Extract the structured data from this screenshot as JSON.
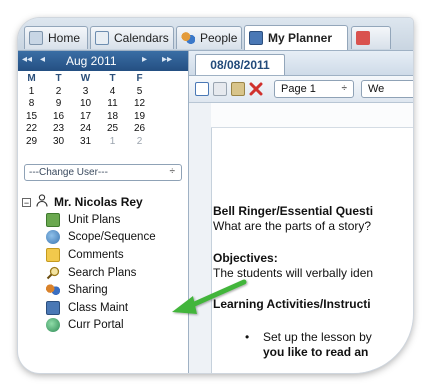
{
  "tabs": [
    {
      "label": "Home",
      "icon": "home-icon"
    },
    {
      "label": "Calendars",
      "icon": "calendar-icon"
    },
    {
      "label": "People",
      "icon": "people-icon"
    },
    {
      "label": "My Planner",
      "icon": "planner-icon",
      "active": true
    }
  ],
  "calendar": {
    "month": "Aug 2011",
    "nav_prev_year": "◂◂",
    "nav_prev": "◂",
    "nav_next": "▸",
    "nav_next_year": "▸▸",
    "day_headers": [
      "M",
      "T",
      "W",
      "T",
      "F"
    ],
    "weeks": [
      [
        "1",
        "2",
        "3",
        "4",
        "5"
      ],
      [
        "8",
        "9",
        "10",
        "11",
        "12"
      ],
      [
        "15",
        "16",
        "17",
        "18",
        "19"
      ],
      [
        "22",
        "23",
        "24",
        "25",
        "26"
      ],
      [
        "29",
        "30",
        "31",
        "1",
        "2"
      ]
    ]
  },
  "change_user": {
    "label": "---Change User---",
    "arrow": "÷"
  },
  "user": {
    "toggle": "−",
    "name": "Mr. Nicolas Rey"
  },
  "tree_items": [
    {
      "label": "Unit Plans",
      "icon": "unit-plans-icon",
      "color": "#6aa84f"
    },
    {
      "label": "Scope/Sequence",
      "icon": "globe-icon",
      "color": "#5a8fc4"
    },
    {
      "label": "Comments",
      "icon": "note-icon",
      "color": "#f2c94c"
    },
    {
      "label": "Search Plans",
      "icon": "magnifier-icon",
      "color": "#c9a227"
    },
    {
      "label": "Sharing",
      "icon": "sharing-icon",
      "color": "#b55a3a"
    },
    {
      "label": "Class Maint",
      "icon": "edit-icon",
      "color": "#4a78b5"
    },
    {
      "label": "Curr Portal",
      "icon": "portal-icon",
      "color": "#4aa36f"
    }
  ],
  "date_tab": "08/08/2011",
  "toolbar": {
    "page_select": "Page 1",
    "page_arrow": "÷",
    "week_select": "We"
  },
  "document": {
    "bell_ringer_title": "Bell Ringer/Essential Questi",
    "bell_ringer_text": "What are the parts of a story?",
    "objectives_title": "Objectives:",
    "objectives_text": "The students will verbally iden",
    "activities_title": "Learning Activities/Instructi",
    "bullet_char": "•",
    "bullet_line1": "Set up the lesson by",
    "bullet_line2": "you like to read an"
  },
  "colors": {
    "accent": "#244f82",
    "arrow": "#43b53a"
  }
}
